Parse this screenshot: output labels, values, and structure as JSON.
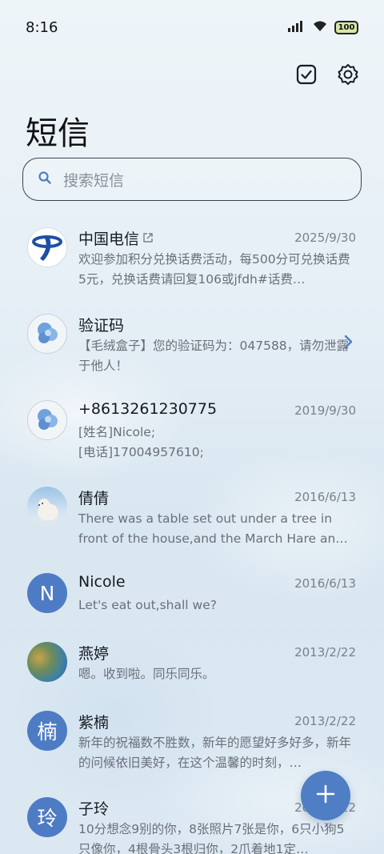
{
  "status_bar": {
    "time": "8:16",
    "battery": "100"
  },
  "header": {
    "title": "短信"
  },
  "search": {
    "placeholder": "搜索短信"
  },
  "conversations": [
    {
      "name": "中国电信",
      "date": "2025/9/30",
      "preview": "欢迎参加积分兑换话费活动，每500分可兑换话费5元，兑换话费请回复106或jfdh#话费…",
      "avatar": "china-telecom-logo"
    },
    {
      "name": "验证码",
      "date": "",
      "preview": "【毛绒盒子】您的验证码为：047588，请勿泄露于他人！",
      "avatar": "blue-flower-avatar"
    },
    {
      "name": "+8613261230775",
      "date": "2019/9/30",
      "preview": "[姓名]Nicole;\n[电话]17004957610;",
      "avatar": "blue-flower-avatar"
    },
    {
      "name": "倩倩",
      "date": "2016/6/13",
      "preview": "There was a table set out under a tree in front of the house,and the March Hare an…",
      "avatar": "polar-bear-avatar"
    },
    {
      "name": "Nicole",
      "date": "2016/6/13",
      "preview": "Let's eat out,shall we?",
      "avatar_letter": "N"
    },
    {
      "name": "燕婷",
      "date": "2013/2/22",
      "preview": "嗯。收到啦。同乐同乐。",
      "avatar": "landscape-avatar"
    },
    {
      "name": "紫楠",
      "date": "2013/2/22",
      "preview": "新年的祝福数不胜数，新年的愿望好多好多，新年的问候依旧美好，在这个温馨的时刻，…",
      "avatar_letter": "楠"
    },
    {
      "name": "子玲",
      "date": "2013/2/22",
      "preview": "10分想念9别的你，8张照片7张是你，6只小狗5只像你，4根骨头3根归你，2爪着地1定…",
      "avatar_letter": "玲"
    }
  ],
  "colors": {
    "accent": "#4f7ec5",
    "telecom_blue": "#1d4fa6"
  },
  "icons": [
    "select-checkbox-icon",
    "settings-gear-icon",
    "search-icon",
    "chevron-right-icon",
    "compose-plus-icon"
  ]
}
